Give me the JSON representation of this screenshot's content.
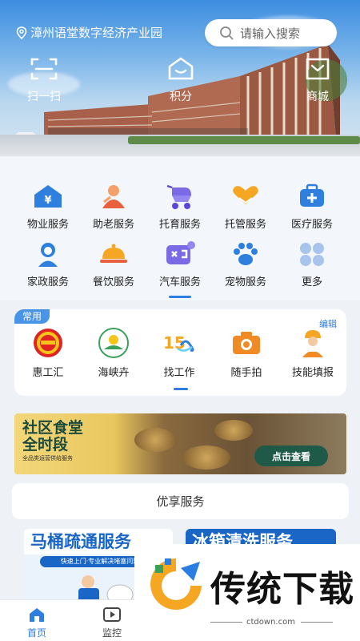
{
  "header": {
    "location": "漳州语堂数字经济产业园",
    "search_placeholder": "请输入搜索"
  },
  "quick_actions": [
    {
      "label": "扫一扫",
      "icon": "scan-icon"
    },
    {
      "label": "积分",
      "icon": "points-icon"
    },
    {
      "label": "商城",
      "icon": "mall-icon"
    }
  ],
  "services": [
    {
      "label": "物业服务",
      "icon": "property-house-icon"
    },
    {
      "label": "助老服务",
      "icon": "elderly-care-icon"
    },
    {
      "label": "托育服务",
      "icon": "stroller-icon"
    },
    {
      "label": "托管服务",
      "icon": "heart-hands-icon"
    },
    {
      "label": "医疗服务",
      "icon": "medical-kit-icon"
    },
    {
      "label": "家政服务",
      "icon": "housekeeper-icon"
    },
    {
      "label": "餐饮服务",
      "icon": "dining-cloche-icon"
    },
    {
      "label": "汽车服务",
      "icon": "car-service-icon"
    },
    {
      "label": "宠物服务",
      "icon": "paw-icon"
    },
    {
      "label": "更多",
      "icon": "more-grid-icon"
    }
  ],
  "favorites": {
    "tag": "常用",
    "edit_label": "编辑",
    "items": [
      {
        "label": "惠工汇",
        "icon": "union-logo-icon"
      },
      {
        "label": "海峡卉",
        "icon": "flower-logo-icon"
      },
      {
        "label": "找工作",
        "icon": "job-15-icon"
      },
      {
        "label": "随手拍",
        "icon": "camera-icon"
      },
      {
        "label": "技能填报",
        "icon": "worker-helmet-icon"
      }
    ]
  },
  "banner": {
    "title_line1": "社区食堂",
    "title_line2": "全时段",
    "subtitle": "全品类运营供给服务",
    "cta": "点击查看"
  },
  "premium": {
    "title": "优享服务",
    "promos": [
      {
        "title": "马桶疏通服务",
        "subtitle": "快速上门·专业解决堵塞问题"
      },
      {
        "title": "冰箱清洗服务"
      }
    ]
  },
  "watermark": {
    "title": "传统下载",
    "url": "ctdown.com"
  },
  "tabbar": [
    {
      "label": "首页",
      "active": true
    },
    {
      "label": "监控",
      "active": false
    }
  ],
  "colors": {
    "accent": "#2e7de0",
    "text": "#222222",
    "background": "#eef2f7"
  }
}
